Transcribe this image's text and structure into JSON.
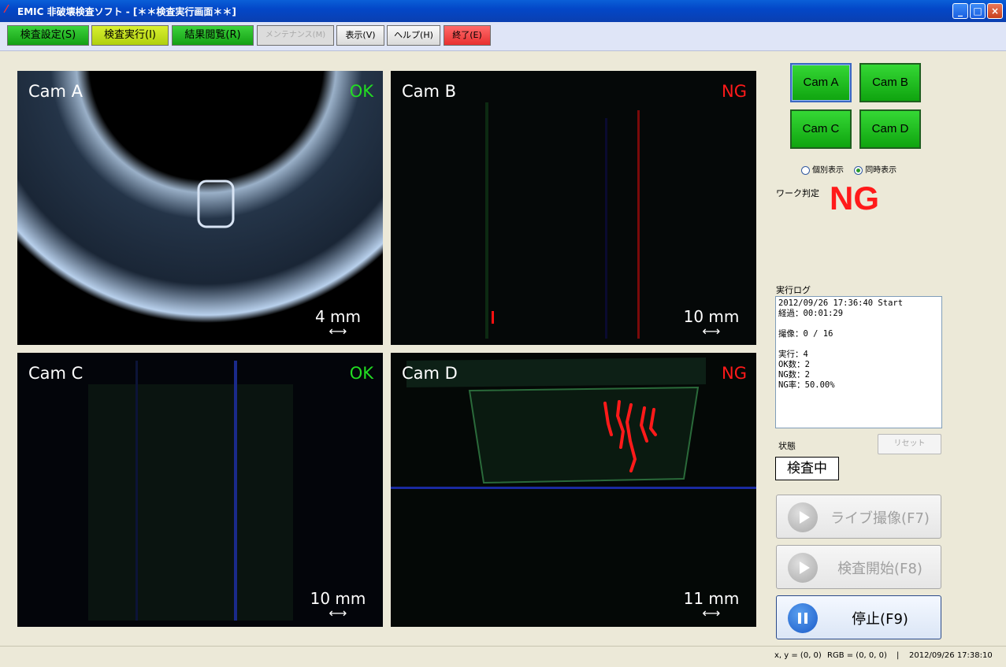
{
  "window": {
    "title": "EMIC 非破壊検査ソフト - [＊＊検査実行画面＊＊]"
  },
  "menu": {
    "settings": "検査設定(S)",
    "run": "検査実行(I)",
    "results": "結果閲覧(R)",
    "maintenance": "メンテナンス(M)",
    "view": "表示(V)",
    "help": "ヘルプ(H)",
    "exit": "終了(E)"
  },
  "cameras": [
    {
      "label": "Cam A",
      "result": "OK",
      "scale": "4 mm"
    },
    {
      "label": "Cam B",
      "result": "NG",
      "scale": "10 mm"
    },
    {
      "label": "Cam C",
      "result": "OK",
      "scale": "10 mm"
    },
    {
      "label": "Cam D",
      "result": "NG",
      "scale": "11 mm"
    }
  ],
  "camera_buttons": [
    "Cam A",
    "Cam B",
    "Cam C",
    "Cam D"
  ],
  "display_mode": {
    "individual": "個別表示",
    "simultaneous": "同時表示",
    "selected": "simultaneous"
  },
  "judgement": {
    "label": "ワーク判定",
    "value": "NG"
  },
  "log": {
    "label": "実行ログ",
    "text": "2012/09/26 17:36:40 Start\n経過：00:01:29\n\n撮像：0 / 16\n\n実行：4\nOK数：2\nNG数：2\nNG率：50.00%"
  },
  "reset": "リセット",
  "state": {
    "label": "状態",
    "value": "検査中"
  },
  "actions": {
    "live": "ライブ撮像(F7)",
    "start": "検査開始(F8)",
    "stop": "停止(F9)"
  },
  "status": {
    "coords": "x, y = (0, 0)",
    "rgb": "RGB = (0, 0, 0)",
    "separator": "|",
    "datetime": "2012/09/26 17:38:10"
  },
  "colors": {
    "ok": "#22dd22",
    "ng": "#ff1a1a",
    "button_green": "#22c022",
    "button_yellow": "#c8e020"
  }
}
